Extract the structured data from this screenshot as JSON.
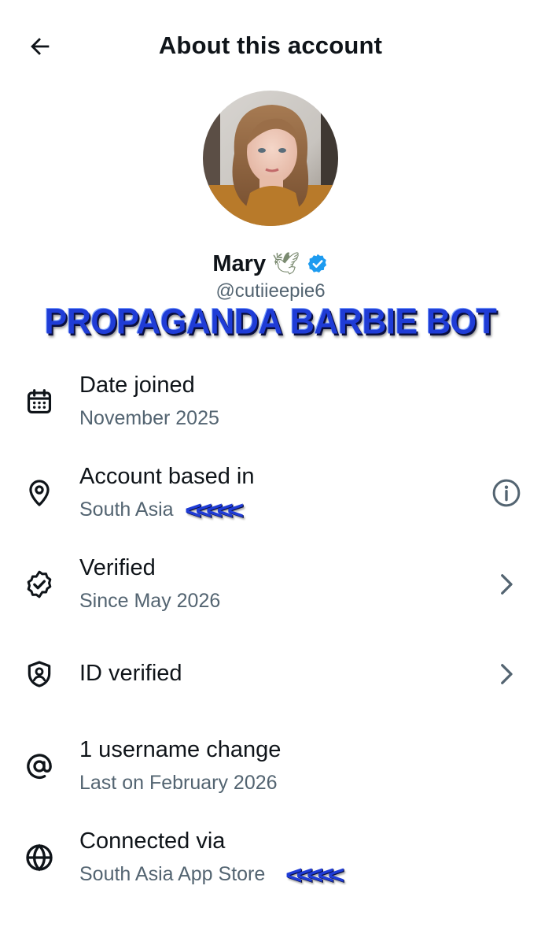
{
  "header": {
    "title": "About this account",
    "back_icon": "arrow-left-icon"
  },
  "profile": {
    "name": "Mary",
    "name_emoji": "🕊",
    "handle": "@cutiieepie6",
    "verified_badge": "verified-badge-icon",
    "badge_color": "#1d9bf0"
  },
  "overlay": {
    "banner": "PROPAGANDA BARBIE BOT",
    "arrows": "<<<<<",
    "color": "#1f3cd6"
  },
  "rows": [
    {
      "icon": "calendar-icon",
      "label": "Date joined",
      "value": "November 2025"
    },
    {
      "icon": "location-pin-icon",
      "label": "Account based in",
      "value": "South Asia",
      "action": "info-icon"
    },
    {
      "icon": "verified-seal-icon",
      "label": "Verified",
      "value": "Since May 2026",
      "action": "chevron-right-icon"
    },
    {
      "icon": "shield-user-icon",
      "label": "ID verified",
      "action": "chevron-right-icon"
    },
    {
      "icon": "at-sign-icon",
      "label": "1 username change",
      "value": "Last on February 2026"
    },
    {
      "icon": "globe-icon",
      "label": "Connected via",
      "value": "South Asia App Store"
    }
  ],
  "colors": {
    "text_primary": "#0f1419",
    "text_secondary": "#536471",
    "background": "#ffffff"
  }
}
